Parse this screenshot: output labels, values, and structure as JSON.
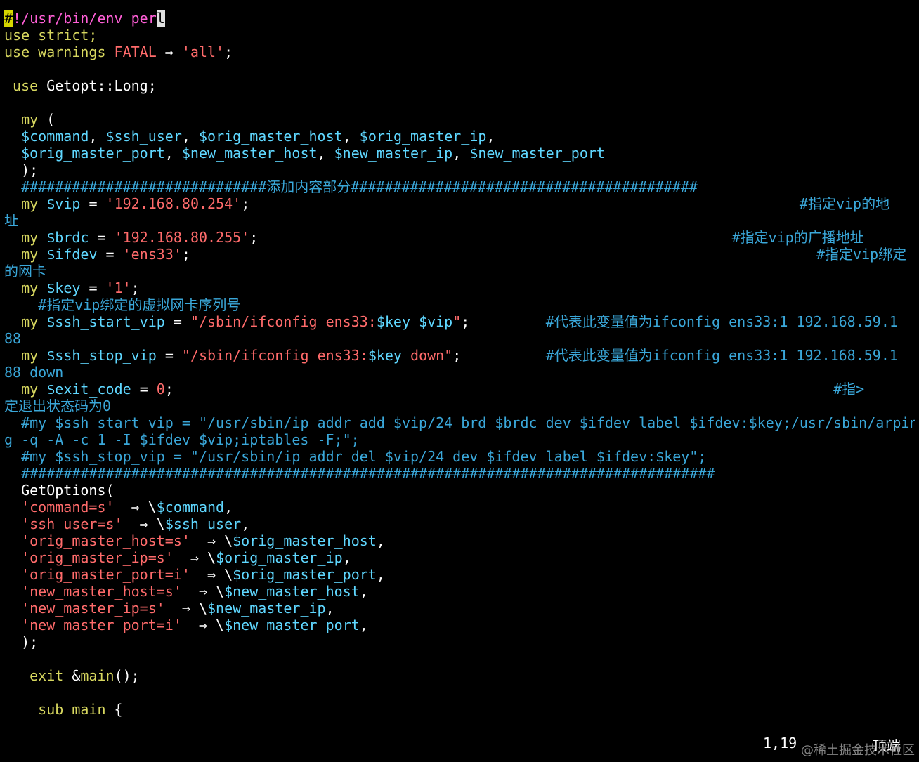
{
  "editor": {
    "colors": {
      "background": "#000000",
      "keyword": "#d7d75f",
      "variable": "#5fd7ff",
      "string": "#ff6b6b",
      "comment": "#3aa7d9",
      "shebang": "#ff5fd7",
      "plain": "#ffffff"
    },
    "lines": [
      [
        [
          "sh",
          "#!/usr/bin/env perl"
        ]
      ],
      [
        [
          "kw",
          "use strict;"
        ]
      ],
      [
        [
          "kw",
          "use warnings "
        ],
        [
          "str",
          "FATAL"
        ],
        [
          "id",
          " ⇒ "
        ],
        [
          "str",
          "'all'"
        ],
        [
          "id",
          ";"
        ]
      ],
      [],
      [
        [
          "id",
          " "
        ],
        [
          "kw",
          "use"
        ],
        [
          "id",
          " Getopt::Long;"
        ]
      ],
      [],
      [
        [
          "id",
          "  "
        ],
        [
          "kw",
          "my"
        ],
        [
          "id",
          " ("
        ]
      ],
      [
        [
          "id",
          "  "
        ],
        [
          "var",
          "$command"
        ],
        [
          "id",
          ", "
        ],
        [
          "var",
          "$ssh_user"
        ],
        [
          "id",
          ", "
        ],
        [
          "var",
          "$orig_master_host"
        ],
        [
          "id",
          ", "
        ],
        [
          "var",
          "$orig_master_ip"
        ],
        [
          "id",
          ","
        ]
      ],
      [
        [
          "id",
          "  "
        ],
        [
          "var",
          "$orig_master_port"
        ],
        [
          "id",
          ", "
        ],
        [
          "var",
          "$new_master_host"
        ],
        [
          "id",
          ", "
        ],
        [
          "var",
          "$new_master_ip"
        ],
        [
          "id",
          ", "
        ],
        [
          "var",
          "$new_master_port"
        ]
      ],
      [
        [
          "id",
          "  );"
        ]
      ],
      [
        [
          "id",
          "  "
        ],
        [
          "cmt",
          "#############################添加内容部分#########################################"
        ]
      ],
      [
        [
          "id",
          "  "
        ],
        [
          "kw",
          "my"
        ],
        [
          "id",
          " "
        ],
        [
          "var",
          "$vip"
        ],
        [
          "id",
          " = "
        ],
        [
          "str",
          "'192.168.80.254'"
        ],
        [
          "id",
          ";                                                                 "
        ],
        [
          "cmt",
          "#指定vip的地"
        ]
      ],
      [
        [
          "cmt",
          "址"
        ]
      ],
      [
        [
          "id",
          "  "
        ],
        [
          "kw",
          "my"
        ],
        [
          "id",
          " "
        ],
        [
          "var",
          "$brdc"
        ],
        [
          "id",
          " = "
        ],
        [
          "str",
          "'192.168.80.255'"
        ],
        [
          "id",
          ";                                                        "
        ],
        [
          "cmt",
          "#指定vip的广播地址"
        ]
      ],
      [
        [
          "id",
          "  "
        ],
        [
          "kw",
          "my"
        ],
        [
          "id",
          " "
        ],
        [
          "var",
          "$ifdev"
        ],
        [
          "id",
          " = "
        ],
        [
          "str",
          "'ens33'"
        ],
        [
          "id",
          ";                                                                          "
        ],
        [
          "cmt",
          "#指定vip绑定"
        ]
      ],
      [
        [
          "cmt",
          "的网卡"
        ]
      ],
      [
        [
          "id",
          "  "
        ],
        [
          "kw",
          "my"
        ],
        [
          "id",
          " "
        ],
        [
          "var",
          "$key"
        ],
        [
          "id",
          " = "
        ],
        [
          "str",
          "'1'"
        ],
        [
          "id",
          ";"
        ]
      ],
      [
        [
          "id",
          "    "
        ],
        [
          "cmt",
          "#指定vip绑定的虚拟网卡序列号"
        ]
      ],
      [
        [
          "id",
          "  "
        ],
        [
          "kw",
          "my"
        ],
        [
          "id",
          " "
        ],
        [
          "var",
          "$ssh_start_vip"
        ],
        [
          "id",
          " = "
        ],
        [
          "str",
          "\"/sbin/ifconfig ens33:"
        ],
        [
          "var",
          "$key"
        ],
        [
          "id",
          " "
        ],
        [
          "var",
          "$vip"
        ],
        [
          "str",
          "\""
        ],
        [
          "id",
          ";         "
        ],
        [
          "cmt",
          "#代表此变量值为ifconfig ens33:1 192.168.59.1"
        ]
      ],
      [
        [
          "cmt",
          "88"
        ]
      ],
      [
        [
          "id",
          "  "
        ],
        [
          "kw",
          "my"
        ],
        [
          "id",
          " "
        ],
        [
          "var",
          "$ssh_stop_vip"
        ],
        [
          "id",
          " = "
        ],
        [
          "str",
          "\"/sbin/ifconfig ens33:"
        ],
        [
          "var",
          "$key"
        ],
        [
          "str",
          " down\""
        ],
        [
          "id",
          ";          "
        ],
        [
          "cmt",
          "#代表此变量值为ifconfig ens33:1 192.168.59.1"
        ]
      ],
      [
        [
          "cmt",
          "88 down"
        ]
      ],
      [
        [
          "id",
          "  "
        ],
        [
          "kw",
          "my"
        ],
        [
          "id",
          " "
        ],
        [
          "var",
          "$exit_code"
        ],
        [
          "id",
          " = "
        ],
        [
          "num",
          "0"
        ],
        [
          "id",
          ";                                                                              "
        ],
        [
          "cmt",
          "#指>"
        ]
      ],
      [
        [
          "cmt",
          "定退出状态码为0"
        ]
      ],
      [
        [
          "id",
          "  "
        ],
        [
          "cmt",
          "#my $ssh_start_vip = \"/usr/sbin/ip addr add $vip/24 brd $brdc dev $ifdev label $ifdev:$key;/usr/sbin/arpin"
        ]
      ],
      [
        [
          "cmt",
          "g -q -A -c 1 -I $ifdev $vip;iptables -F;\";"
        ]
      ],
      [
        [
          "id",
          "  "
        ],
        [
          "cmt",
          "#my $ssh_stop_vip = \"/usr/sbin/ip addr del $vip/24 dev $ifdev label $ifdev:$key\";"
        ]
      ],
      [
        [
          "id",
          "  "
        ],
        [
          "cmt",
          "##################################################################################"
        ]
      ],
      [
        [
          "id",
          "  GetOptions("
        ]
      ],
      [
        [
          "id",
          "  "
        ],
        [
          "str",
          "'command=s'"
        ],
        [
          "id",
          "  ⇒ \\"
        ],
        [
          "var",
          "$command"
        ],
        [
          "id",
          ","
        ]
      ],
      [
        [
          "id",
          "  "
        ],
        [
          "str",
          "'ssh_user=s'"
        ],
        [
          "id",
          "  ⇒ \\"
        ],
        [
          "var",
          "$ssh_user"
        ],
        [
          "id",
          ","
        ]
      ],
      [
        [
          "id",
          "  "
        ],
        [
          "str",
          "'orig_master_host=s'"
        ],
        [
          "id",
          "  ⇒ \\"
        ],
        [
          "var",
          "$orig_master_host"
        ],
        [
          "id",
          ","
        ]
      ],
      [
        [
          "id",
          "  "
        ],
        [
          "str",
          "'orig_master_ip=s'"
        ],
        [
          "id",
          "  ⇒ \\"
        ],
        [
          "var",
          "$orig_master_ip"
        ],
        [
          "id",
          ","
        ]
      ],
      [
        [
          "id",
          "  "
        ],
        [
          "str",
          "'orig_master_port=i'"
        ],
        [
          "id",
          "  ⇒ \\"
        ],
        [
          "var",
          "$orig_master_port"
        ],
        [
          "id",
          ","
        ]
      ],
      [
        [
          "id",
          "  "
        ],
        [
          "str",
          "'new_master_host=s'"
        ],
        [
          "id",
          "  ⇒ \\"
        ],
        [
          "var",
          "$new_master_host"
        ],
        [
          "id",
          ","
        ]
      ],
      [
        [
          "id",
          "  "
        ],
        [
          "str",
          "'new_master_ip=s'"
        ],
        [
          "id",
          "  ⇒ \\"
        ],
        [
          "var",
          "$new_master_ip"
        ],
        [
          "id",
          ","
        ]
      ],
      [
        [
          "id",
          "  "
        ],
        [
          "str",
          "'new_master_port=i'"
        ],
        [
          "id",
          "  ⇒ \\"
        ],
        [
          "var",
          "$new_master_port"
        ],
        [
          "id",
          ","
        ]
      ],
      [
        [
          "id",
          "  );"
        ]
      ],
      [],
      [
        [
          "id",
          "   "
        ],
        [
          "kw",
          "exit"
        ],
        [
          "id",
          " &"
        ],
        [
          "kw",
          "main"
        ],
        [
          "id",
          "();"
        ]
      ],
      [],
      [
        [
          "id",
          "    "
        ],
        [
          "kw",
          "sub"
        ],
        [
          "id",
          " "
        ],
        [
          "kw",
          "main"
        ],
        [
          "id",
          " {"
        ]
      ]
    ]
  },
  "status": {
    "position": "1,19",
    "scroll": "顶端"
  },
  "watermark": "@稀土掘金技术社区"
}
